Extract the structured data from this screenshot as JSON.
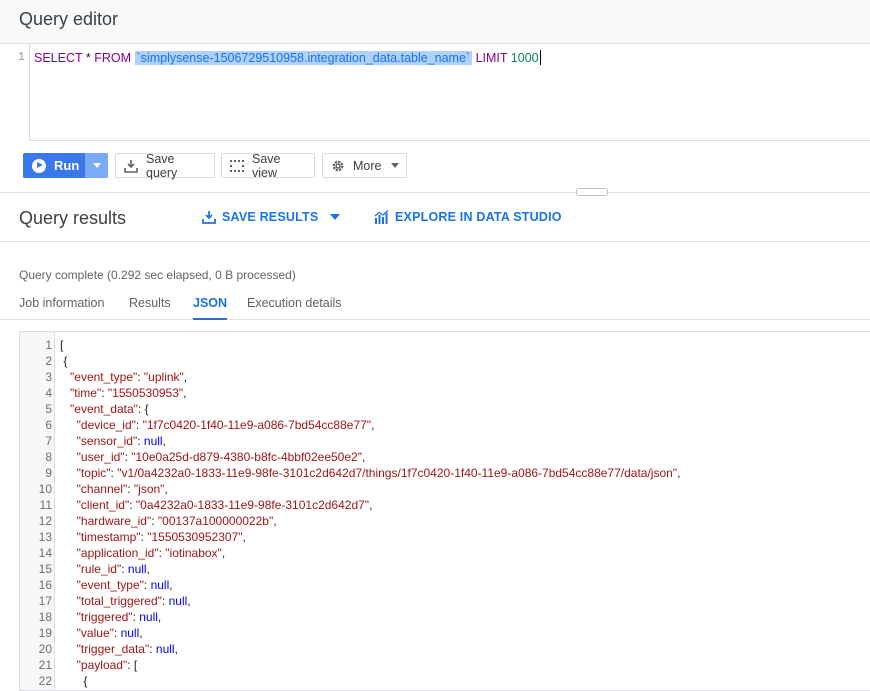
{
  "editor": {
    "title": "Query editor",
    "line_number": "1",
    "sql": {
      "select": "SELECT",
      "star": " * ",
      "from": "FROM",
      "table": "`simplysense-1506729510958.integration_data.table_name`",
      "limit": "LIMIT",
      "limit_value": "1000"
    }
  },
  "toolbar": {
    "run_label": "Run",
    "save_query_label": "Save query",
    "save_view_label": "Save view",
    "more_label": "More"
  },
  "results": {
    "title": "Query results",
    "save_results_label": "SAVE RESULTS",
    "explore_label": "EXPLORE IN DATA STUDIO",
    "status": "Query complete (0.292 sec elapsed, 0 B processed)",
    "tabs": [
      {
        "label": "Job information",
        "active": false
      },
      {
        "label": "Results",
        "active": false
      },
      {
        "label": "JSON",
        "active": true
      },
      {
        "label": "Execution details",
        "active": false
      }
    ]
  },
  "json_lines": [
    {
      "n": "1",
      "indent": "",
      "key": "",
      "val": "",
      "type": "open",
      "text": "["
    },
    {
      "n": "2",
      "indent": " ",
      "key": "",
      "val": "",
      "type": "open",
      "text": "{"
    },
    {
      "n": "3",
      "indent": "   ",
      "key": "\"event_type\"",
      "val": "\"uplink\"",
      "type": "str",
      "tail": ","
    },
    {
      "n": "4",
      "indent": "   ",
      "key": "\"time\"",
      "val": "\"1550530953\"",
      "type": "str",
      "tail": ","
    },
    {
      "n": "5",
      "indent": "   ",
      "key": "\"event_data\"",
      "val": "{",
      "type": "punct",
      "tail": ""
    },
    {
      "n": "6",
      "indent": "     ",
      "key": "\"device_id\"",
      "val": "\"1f7c0420-1f40-11e9-a086-7bd54cc88e77\"",
      "type": "str",
      "tail": ","
    },
    {
      "n": "7",
      "indent": "     ",
      "key": "\"sensor_id\"",
      "val": "null",
      "type": "null",
      "tail": ","
    },
    {
      "n": "8",
      "indent": "     ",
      "key": "\"user_id\"",
      "val": "\"10e0a25d-d879-4380-b8fc-4bbf02ee50e2\"",
      "type": "str",
      "tail": ","
    },
    {
      "n": "9",
      "indent": "     ",
      "key": "\"topic\"",
      "val": "\"v1/0a4232a0-1833-11e9-98fe-3101c2d642d7/things/1f7c0420-1f40-11e9-a086-7bd54cc88e77/data/json\"",
      "type": "str",
      "tail": ","
    },
    {
      "n": "10",
      "indent": "     ",
      "key": "\"channel\"",
      "val": "\"json\"",
      "type": "str",
      "tail": ","
    },
    {
      "n": "11",
      "indent": "     ",
      "key": "\"client_id\"",
      "val": "\"0a4232a0-1833-11e9-98fe-3101c2d642d7\"",
      "type": "str",
      "tail": ","
    },
    {
      "n": "12",
      "indent": "     ",
      "key": "\"hardware_id\"",
      "val": "\"00137a100000022b\"",
      "type": "str",
      "tail": ","
    },
    {
      "n": "13",
      "indent": "     ",
      "key": "\"timestamp\"",
      "val": "\"1550530952307\"",
      "type": "str",
      "tail": ","
    },
    {
      "n": "14",
      "indent": "     ",
      "key": "\"application_id\"",
      "val": "\"iotinabox\"",
      "type": "str",
      "tail": ","
    },
    {
      "n": "15",
      "indent": "     ",
      "key": "\"rule_id\"",
      "val": "null",
      "type": "null",
      "tail": ","
    },
    {
      "n": "16",
      "indent": "     ",
      "key": "\"event_type\"",
      "val": "null",
      "type": "null",
      "tail": ","
    },
    {
      "n": "17",
      "indent": "     ",
      "key": "\"total_triggered\"",
      "val": "null",
      "type": "null",
      "tail": ","
    },
    {
      "n": "18",
      "indent": "     ",
      "key": "\"triggered\"",
      "val": "null",
      "type": "null",
      "tail": ","
    },
    {
      "n": "19",
      "indent": "     ",
      "key": "\"value\"",
      "val": "null",
      "type": "null",
      "tail": ","
    },
    {
      "n": "20",
      "indent": "     ",
      "key": "\"trigger_data\"",
      "val": "null",
      "type": "null",
      "tail": ","
    },
    {
      "n": "21",
      "indent": "     ",
      "key": "\"payload\"",
      "val": "[",
      "type": "punct",
      "tail": ""
    },
    {
      "n": "22",
      "indent": "       ",
      "key": "",
      "val": "",
      "type": "open",
      "text": "{"
    }
  ],
  "colors": {
    "accent": "#1a73e8",
    "run_button": "#3b78e7",
    "json_string": "#a31515",
    "json_null": "#0000ff"
  }
}
